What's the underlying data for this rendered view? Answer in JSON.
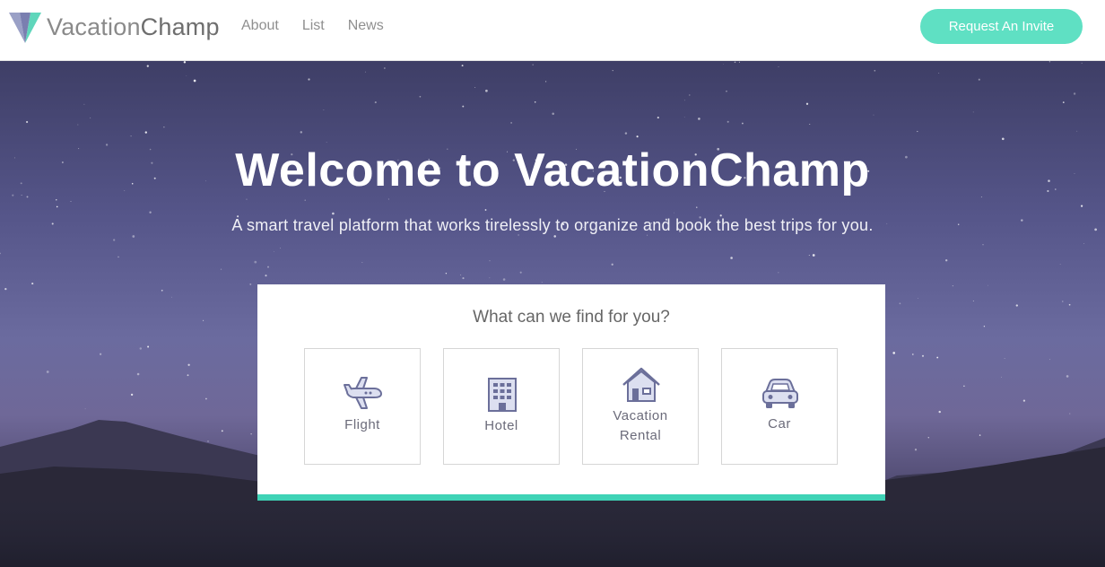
{
  "brand": {
    "name_light": "Vacation",
    "name_strong": "Champ",
    "accent": "#5fe0c3",
    "logo_icon": "vacationchamp-logo-icon"
  },
  "nav": {
    "items": [
      "About",
      "List",
      "News"
    ]
  },
  "header": {
    "invite_label": "Request An Invite"
  },
  "hero": {
    "title": "Welcome to VacationChamp",
    "subtitle": "A smart travel platform that works tirelessly to organize and book the best trips for you."
  },
  "search": {
    "title": "What can we find for you?",
    "options": [
      {
        "label": "Flight",
        "icon": "airplane-icon"
      },
      {
        "label": "Hotel",
        "icon": "hotel-building-icon"
      },
      {
        "label_line1": "Vacation",
        "label_line2": "Rental",
        "icon": "house-icon"
      },
      {
        "label": "Car",
        "icon": "car-icon"
      }
    ]
  },
  "colors": {
    "card_accent": "#3fd3b6",
    "icon_color": "#6b6f9a"
  }
}
